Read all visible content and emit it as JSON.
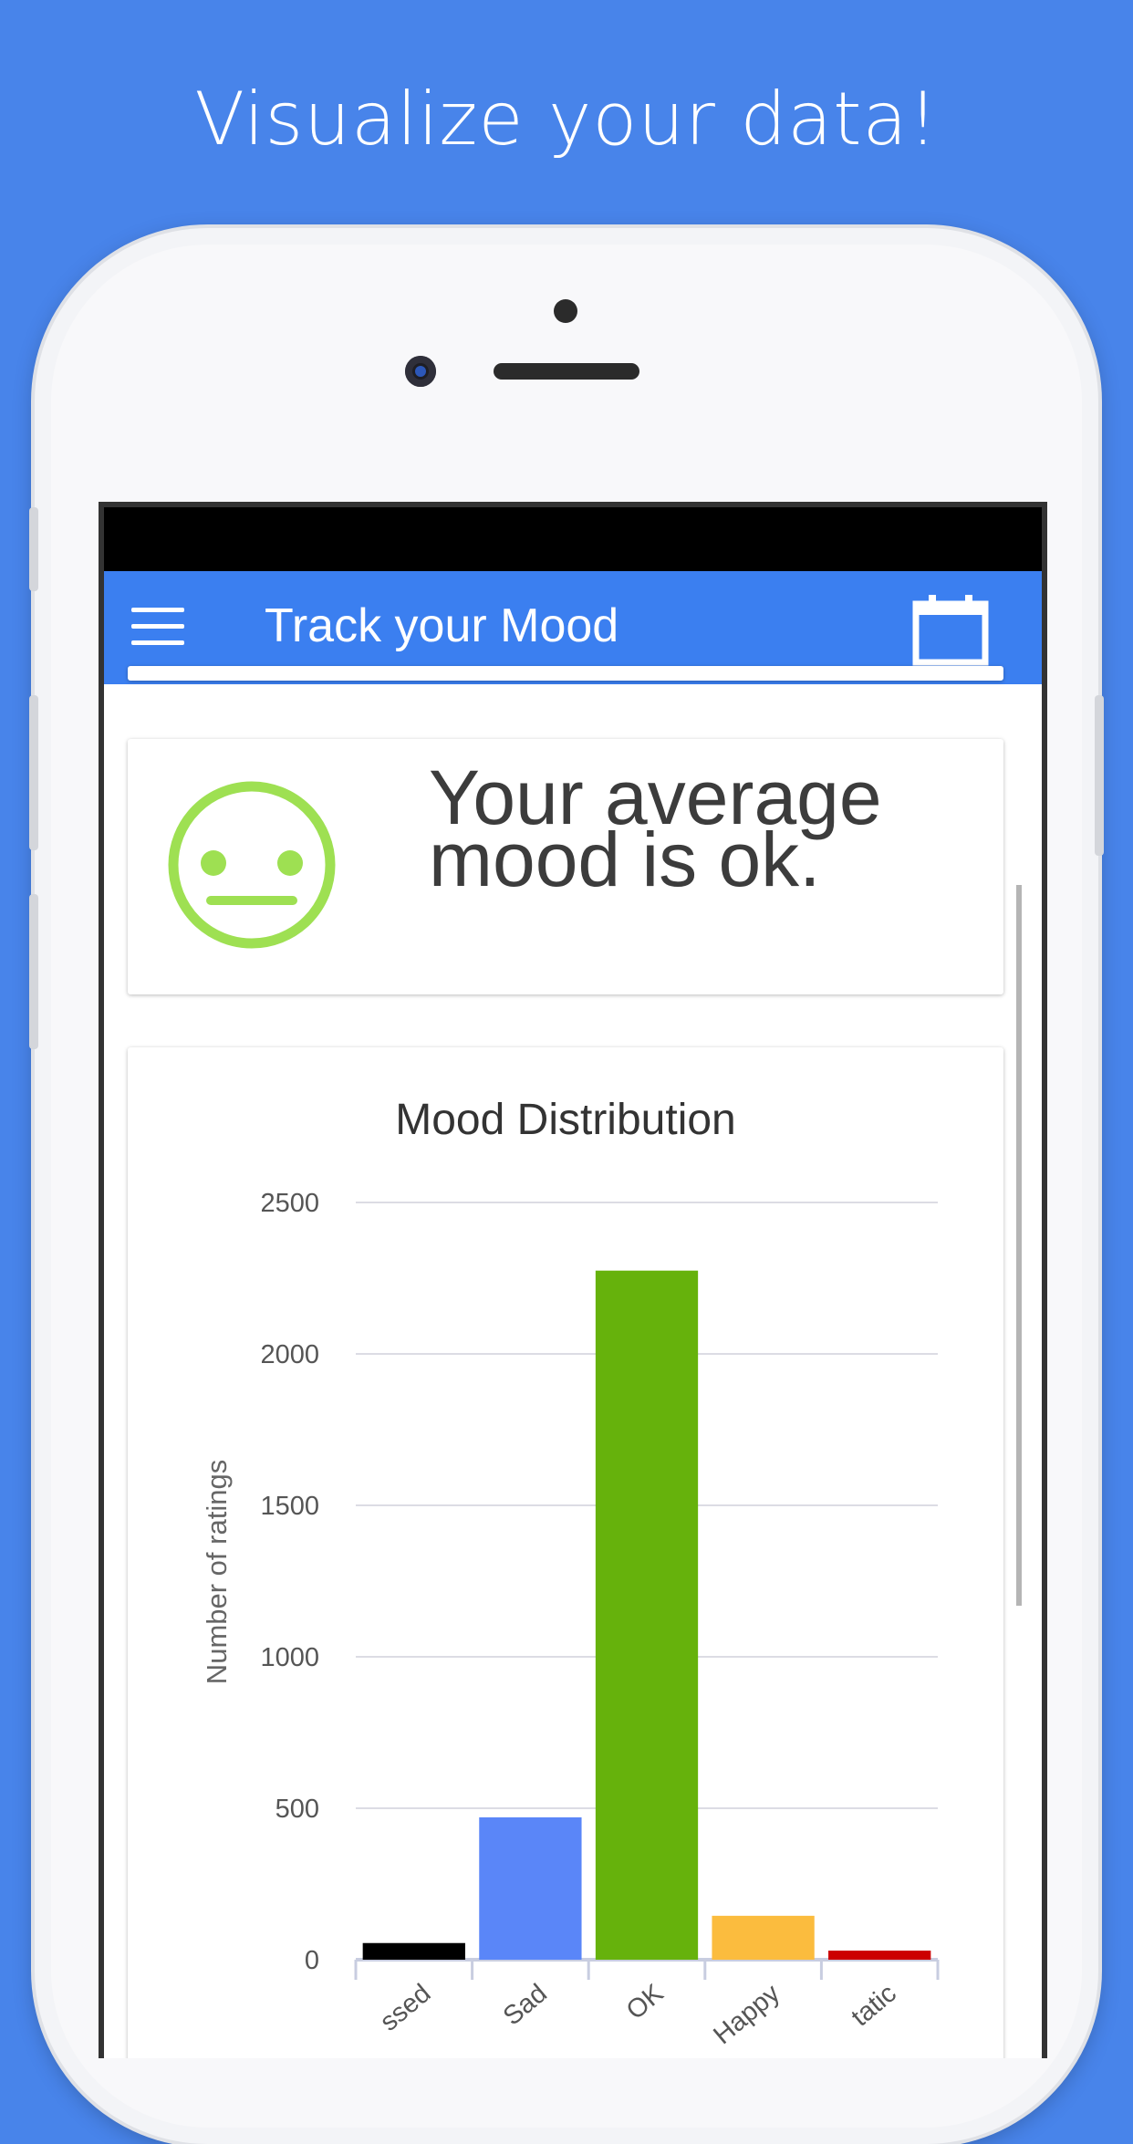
{
  "headline": "Visualize your data!",
  "app": {
    "title": "Track your Mood",
    "menu_icon": "hamburger-menu-icon",
    "calendar_icon": "calendar-icon",
    "bar_color": "#3b7ff0"
  },
  "mood_card": {
    "face_icon": "neutral-face-icon",
    "face_color": "#9ee052",
    "text": "Your average mood is ok."
  },
  "chart_data": {
    "type": "bar",
    "title": "Mood Distribution",
    "ylabel": "Number of ratings",
    "xlabel": "",
    "categories": [
      "Depressed",
      "Sad",
      "OK",
      "Happy",
      "Ecstatic"
    ],
    "category_labels_visible": [
      "ssed",
      "Sad",
      "OK",
      "Happy",
      "tatic"
    ],
    "values": [
      55,
      470,
      2275,
      145,
      30
    ],
    "colors": [
      "#000000",
      "#5a86f8",
      "#66b20c",
      "#fbbc3e",
      "#cc0000"
    ],
    "ylim": [
      0,
      2500
    ],
    "yticks": [
      0,
      500,
      1000,
      1500,
      2000,
      2500
    ],
    "grid": true
  }
}
